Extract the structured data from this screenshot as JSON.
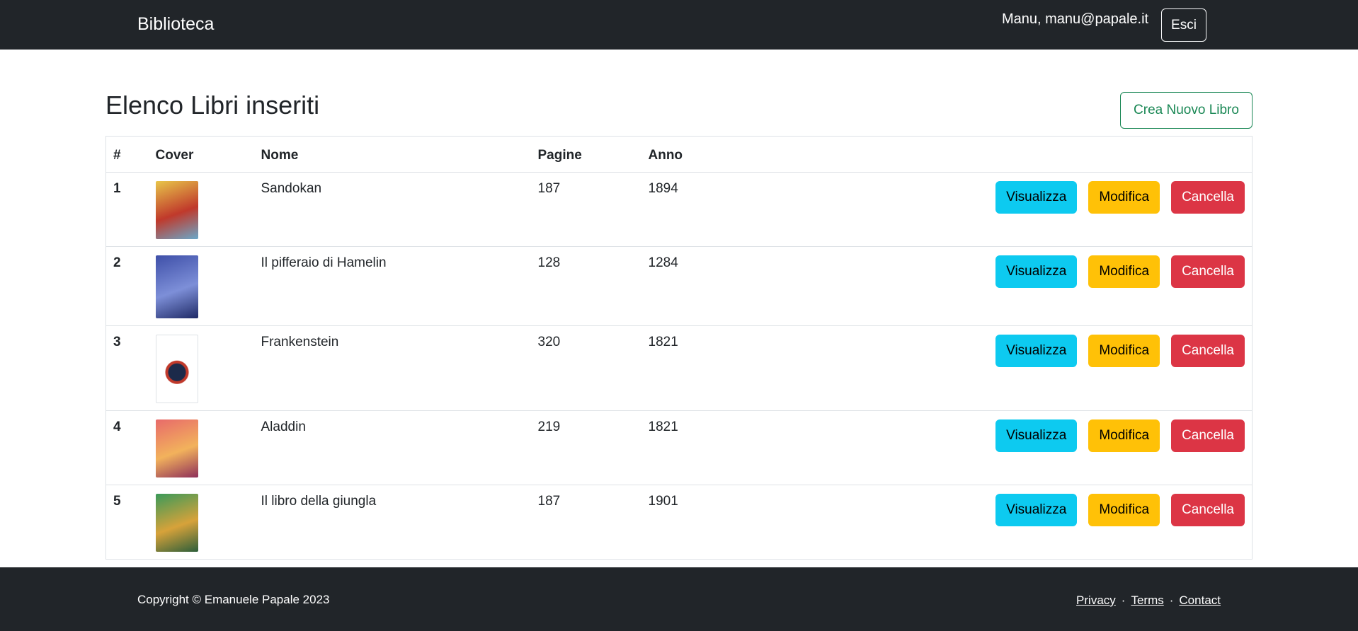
{
  "navbar": {
    "brand": "Biblioteca",
    "user": "Manu, manu@papale.it",
    "logout_label": "Esci"
  },
  "main": {
    "title": "Elenco Libri inseriti",
    "create_label": "Crea Nuovo Libro",
    "columns": [
      "#",
      "Cover",
      "Nome",
      "Pagine",
      "Anno"
    ],
    "action_labels": {
      "view": "Visualizza",
      "edit": "Modifica",
      "delete": "Cancella"
    },
    "books": [
      {
        "index": "1",
        "name": "Sandokan",
        "pages": "187",
        "year": "1894",
        "cover_colors": [
          "#e8c64a",
          "#c0392b",
          "#6aa8c9"
        ]
      },
      {
        "index": "2",
        "name": "Il pifferaio di Hamelin",
        "pages": "128",
        "year": "1284",
        "cover_colors": [
          "#3e4fa8",
          "#7d8fd8",
          "#1f2a66"
        ]
      },
      {
        "index": "3",
        "name": "Frankenstein",
        "pages": "320",
        "year": "1821",
        "cover_colors": [
          "#ffffff",
          "#1c2a4a",
          "#c0392b"
        ]
      },
      {
        "index": "4",
        "name": "Aladdin",
        "pages": "219",
        "year": "1821",
        "cover_colors": [
          "#e86a6a",
          "#f2b25c",
          "#8e2f5a"
        ]
      },
      {
        "index": "5",
        "name": "Il libro della giungla",
        "pages": "187",
        "year": "1901",
        "cover_colors": [
          "#3a9a5a",
          "#d7a23a",
          "#2c5e3a"
        ]
      }
    ]
  },
  "footer": {
    "copyright": "Copyright © Emanuele Papale 2023",
    "links": [
      "Privacy",
      "Terms",
      "Contact"
    ],
    "separator": "·"
  },
  "colors": {
    "dark": "#212529",
    "success": "#198754",
    "info": "#0dcaf0",
    "warning": "#ffc107",
    "danger": "#dc3545"
  }
}
